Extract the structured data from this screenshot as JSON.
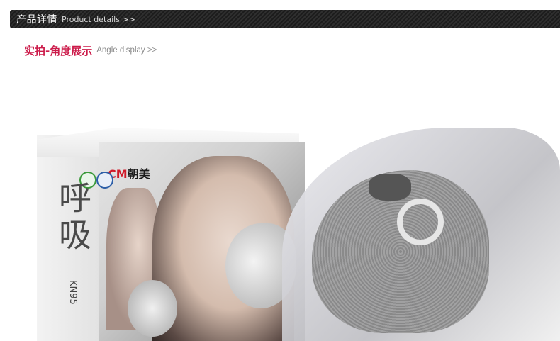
{
  "header": {
    "title_cn": "产品详情",
    "title_en": "Product details >>"
  },
  "section": {
    "title_cn": "实拍-角度展示",
    "title_en": "Angle display >>"
  },
  "product_image": {
    "brand_latin": "CM",
    "brand_cn": "朝美",
    "box_side_text": "呼吸",
    "box_model": "KN95"
  }
}
